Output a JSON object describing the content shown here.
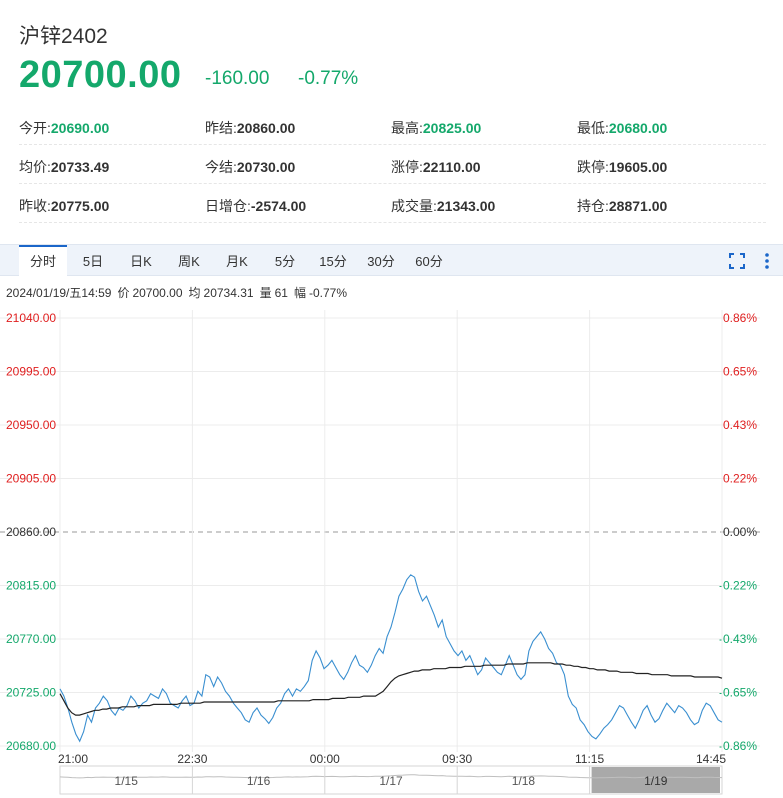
{
  "header": {
    "title": "沪锌2402",
    "price": "20700.00",
    "change_abs": "-160.00",
    "change_pct": "-0.77%"
  },
  "stats": [
    [
      {
        "label": "今开:",
        "value": "20690.00",
        "color": "green"
      },
      {
        "label": "昨结:",
        "value": "20860.00",
        "color": "normal"
      },
      {
        "label": "最高:",
        "value": "20825.00",
        "color": "green"
      },
      {
        "label": "最低:",
        "value": "20680.00",
        "color": "green"
      }
    ],
    [
      {
        "label": "均价:",
        "value": "20733.49",
        "color": "normal"
      },
      {
        "label": "今结:",
        "value": "20730.00",
        "color": "normal"
      },
      {
        "label": "涨停:",
        "value": "22110.00",
        "color": "normal"
      },
      {
        "label": "跌停:",
        "value": "19605.00",
        "color": "normal"
      }
    ],
    [
      {
        "label": "昨收:",
        "value": "20775.00",
        "color": "normal"
      },
      {
        "label": "日增仓:",
        "value": "-2574.00",
        "color": "normal"
      },
      {
        "label": "成交量:",
        "value": "21343.00",
        "color": "normal"
      },
      {
        "label": "持仓:",
        "value": "28871.00",
        "color": "normal"
      }
    ]
  ],
  "tabs": [
    {
      "label": "分时",
      "active": true
    },
    {
      "label": "5日",
      "active": false
    },
    {
      "label": "日K",
      "active": false
    },
    {
      "label": "周K",
      "active": false
    },
    {
      "label": "月K",
      "active": false
    },
    {
      "label": "5分",
      "active": false
    },
    {
      "label": "15分",
      "active": false
    },
    {
      "label": "30分",
      "active": false
    },
    {
      "label": "60分",
      "active": false
    }
  ],
  "toolbar_icons": [
    "fullscreen-icon",
    "more-vertical-icon"
  ],
  "infoline": {
    "datetime": "2024/01/19/五14:59",
    "price_label": "价",
    "price": "20700.00",
    "avg_label": "均",
    "avg": "20734.31",
    "vol_label": "量",
    "vol": "61",
    "amp_label": "幅",
    "amp": "-0.77%"
  },
  "colors": {
    "down_green": "#14a86b",
    "up_red": "#e02020",
    "price_line": "#3a8fd0",
    "avg_line": "#222222",
    "tab_active": "#1b66c9"
  },
  "chart_data": {
    "type": "line",
    "ylim": [
      20680,
      21040
    ],
    "reference_price": 20860,
    "y_ticks_left": [
      "21040.00",
      "20995.00",
      "20950.00",
      "20905.00",
      "20860.00",
      "20815.00",
      "20770.00",
      "20725.00",
      "20680.00"
    ],
    "y_ticks_right": [
      "0.86%",
      "0.65%",
      "0.43%",
      "0.22%",
      "0.00%",
      "-0.22%",
      "-0.43%",
      "-0.65%",
      "-0.86%"
    ],
    "x_ticks": [
      "21:00",
      "22:30",
      "00:00",
      "09:30",
      "11:15",
      "14:45"
    ],
    "navigator_labels": [
      "1/15",
      "1/16",
      "1/17",
      "1/18",
      "1/19"
    ],
    "series": [
      {
        "values": [
          20728,
          20722,
          20712,
          20700,
          20690,
          20684,
          20692,
          20706,
          20700,
          20712,
          20716,
          20722,
          20718,
          20710,
          20706,
          20712,
          20710,
          20714,
          20722,
          20718,
          20712,
          20716,
          20718,
          20724,
          20722,
          20720,
          20728,
          20724,
          20716,
          20714,
          20712,
          20718,
          20722,
          20714,
          20716,
          20726,
          20722,
          20740,
          20738,
          20730,
          20738,
          20733,
          20726,
          20722,
          20716,
          20712,
          20708,
          20702,
          20700,
          20708,
          20712,
          20706,
          20703,
          20699,
          20704,
          20712,
          20716,
          20724,
          20728,
          20722,
          20728,
          20726,
          20730,
          20735,
          20752,
          20760,
          20754,
          20745,
          20748,
          20752,
          20746,
          20740,
          20736,
          20742,
          20750,
          20756,
          20748,
          20746,
          20742,
          20748,
          20756,
          20762,
          20758,
          20772,
          20780,
          20792,
          20806,
          20812,
          20820,
          20824,
          20822,
          20810,
          20802,
          20806,
          20798,
          20790,
          20780,
          20786,
          20772,
          20766,
          20760,
          20756,
          20760,
          20752,
          20756,
          20748,
          20740,
          20744,
          20754,
          20750,
          20746,
          20742,
          20740,
          20748,
          20756,
          20748,
          20740,
          20736,
          20740,
          20760,
          20768,
          20772,
          20776,
          20770,
          20762,
          20758,
          20750,
          20748,
          20740,
          20722,
          20715,
          20712,
          20702,
          20698,
          20692,
          20688,
          20686,
          20690,
          20695,
          20698,
          20702,
          20708,
          20714,
          20712,
          20706,
          20700,
          20695,
          20702,
          20710,
          20714,
          20706,
          20700,
          20703,
          20710,
          20716,
          20712,
          20708,
          20714,
          20712,
          20708,
          20702,
          20698,
          20700,
          20710,
          20716,
          20714,
          20708,
          20702,
          20700
        ]
      },
      {
        "values": [
          20724,
          20718,
          20712,
          20708,
          20706,
          20706,
          20707,
          20708,
          20709,
          20710,
          20710,
          20711,
          20711,
          20712,
          20712,
          20712,
          20713,
          20713,
          20713,
          20713,
          20714,
          20714,
          20714,
          20714,
          20715,
          20715,
          20715,
          20715,
          20715,
          20715,
          20715,
          20716,
          20716,
          20716,
          20716,
          20716,
          20716,
          20717,
          20717,
          20717,
          20717,
          20717,
          20717,
          20717,
          20717,
          20717,
          20717,
          20717,
          20717,
          20717,
          20717,
          20717,
          20717,
          20717,
          20717,
          20717,
          20718,
          20718,
          20718,
          20718,
          20718,
          20718,
          20718,
          20718,
          20718,
          20719,
          20719,
          20719,
          20719,
          20719,
          20720,
          20720,
          20720,
          20720,
          20721,
          20721,
          20721,
          20721,
          20722,
          20722,
          20722,
          20722,
          20724,
          20726,
          20730,
          20734,
          20737,
          20739,
          20740,
          20741,
          20742,
          20743,
          20743,
          20744,
          20744,
          20744,
          20745,
          20745,
          20745,
          20745,
          20746,
          20746,
          20746,
          20746,
          20747,
          20747,
          20747,
          20747,
          20747,
          20748,
          20748,
          20748,
          20748,
          20748,
          20748,
          20749,
          20749,
          20749,
          20749,
          20749,
          20750,
          20750,
          20750,
          20750,
          20750,
          20750,
          20750,
          20749,
          20749,
          20749,
          20748,
          20748,
          20747,
          20747,
          20746,
          20746,
          20745,
          20745,
          20744,
          20744,
          20744,
          20743,
          20743,
          20743,
          20742,
          20742,
          20742,
          20742,
          20741,
          20741,
          20741,
          20741,
          20740,
          20740,
          20740,
          20740,
          20740,
          20739,
          20739,
          20739,
          20739,
          20739,
          20739,
          20738,
          20738,
          20738,
          20738,
          20738,
          20738,
          20738,
          20737
        ]
      }
    ]
  }
}
